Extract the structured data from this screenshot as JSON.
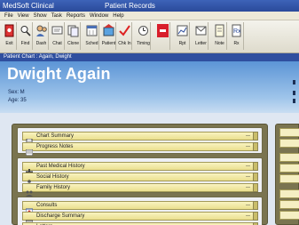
{
  "window": {
    "app_title": "MedSoft Clinical",
    "document_title": "Patient Records"
  },
  "menu": [
    "File",
    "View",
    "Show",
    "Task",
    "Reports",
    "Window",
    "Help"
  ],
  "toolbar": [
    {
      "label": "Exit",
      "icon": "exit-icon"
    },
    {
      "label": "Find",
      "icon": "find-icon"
    },
    {
      "label": "Dash",
      "icon": "dash-icon"
    },
    {
      "label": "Chat",
      "icon": "chat-icon"
    },
    {
      "label": "Clone",
      "icon": "clone-icon"
    },
    {
      "label": "Sched",
      "icon": "schedule-icon"
    },
    {
      "label": "Patient",
      "icon": "patient-icon"
    },
    {
      "label": "Chk In",
      "icon": "check-in-icon"
    },
    {
      "label": "Timing",
      "icon": "timer-icon"
    },
    {
      "label": "",
      "icon": "alert-icon"
    },
    {
      "label": "Rpt",
      "icon": "report-icon"
    },
    {
      "label": "Letter",
      "icon": "letter-icon"
    },
    {
      "label": "Note",
      "icon": "note-icon"
    },
    {
      "label": "Rx",
      "icon": "prescription-icon"
    }
  ],
  "chart_header": "Patient Chart : Again, Dwight",
  "patient": {
    "name": "Dwight Again",
    "sex": "Sex: M",
    "age": "Age: 35"
  },
  "sections": [
    {
      "items": [
        {
          "label": "Chart Summary",
          "icon": "chart-summary-icon",
          "count": "—"
        },
        {
          "label": "Progress Notes",
          "icon": "progress-notes-icon",
          "count": "—"
        }
      ]
    },
    {
      "items": [
        {
          "label": "Past Medical History",
          "icon": "medical-history-icon",
          "count": "—"
        },
        {
          "label": "Social History",
          "icon": "social-history-icon",
          "count": "—"
        },
        {
          "label": "Family History",
          "icon": "family-history-icon",
          "count": "—"
        }
      ]
    },
    {
      "items": [
        {
          "label": "Consults",
          "icon": "consults-icon",
          "count": "—"
        },
        {
          "label": "Discharge Summary",
          "icon": "discharge-summary-icon",
          "count": "—"
        },
        {
          "label": "Letters",
          "icon": "letters-icon",
          "count": ""
        }
      ]
    }
  ],
  "colors": {
    "title_bar": "#2a4a9a",
    "header_gradient_top": "#5c95d6",
    "panel_frame": "#7a7450",
    "row_fill": "#f3ecb0"
  }
}
